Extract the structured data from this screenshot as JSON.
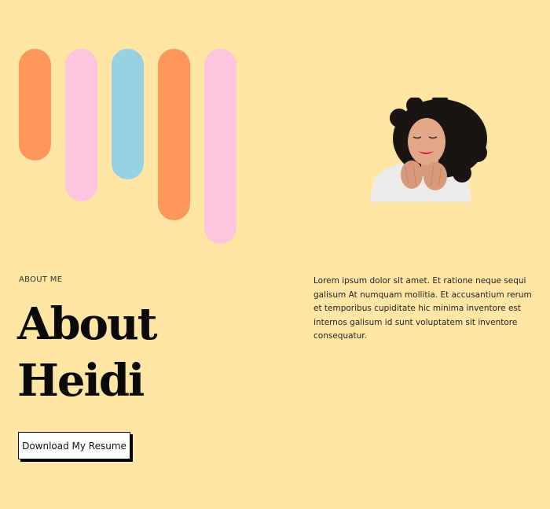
{
  "decor": {
    "bars": [
      {
        "color": "#FF975A",
        "icon": "orange-pill"
      },
      {
        "color": "#FFC5DF",
        "icon": "pink-pill"
      },
      {
        "color": "#95D1E3",
        "icon": "blue-pill"
      },
      {
        "color": "#FF975A",
        "icon": "orange-pill"
      },
      {
        "color": "#FFC5DF",
        "icon": "pink-pill"
      }
    ]
  },
  "portrait": {
    "icon": "woman-portrait-photo"
  },
  "about": {
    "eyebrow": "ABOUT ME",
    "heading_line1": "About",
    "heading_line2": "Heidi",
    "resume_button": "Download My Resume"
  },
  "bio": {
    "text": "Lorem ipsum dolor sit amet. Et ratione neque sequi galisum At numquam mollitia. Et accusantium rerum et temporibus cupiditate hic minima inventore est internos galisum id sunt voluptatem sit inventore consequatur."
  },
  "colors": {
    "background": "#FFE6A5",
    "text": "#111111",
    "button_bg": "#FFFFFF"
  }
}
